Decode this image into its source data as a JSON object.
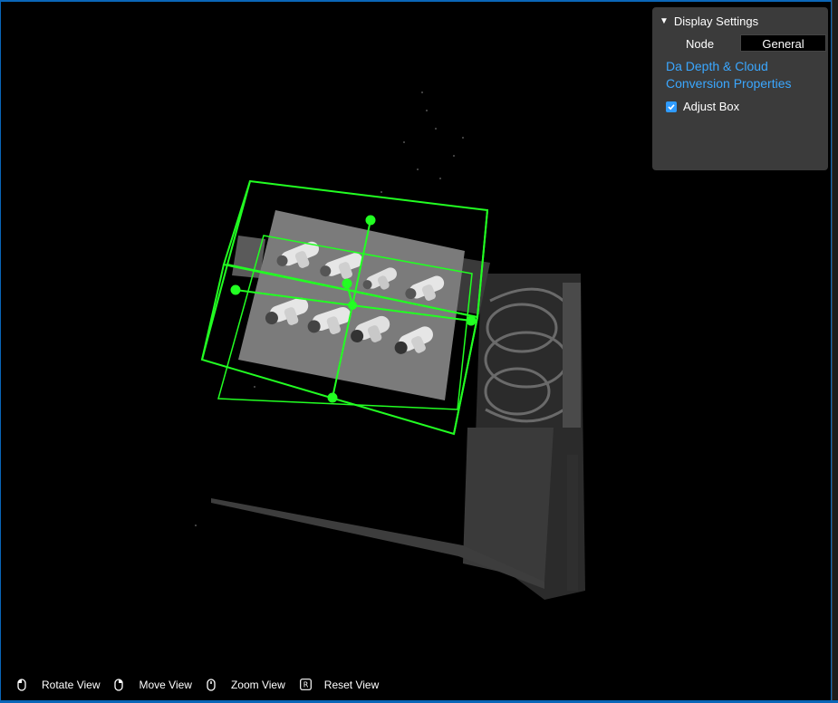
{
  "display_settings": {
    "header": "Display Settings",
    "node_label": "Node",
    "node_value": "General",
    "properties_link": "Da Depth & Cloud Conversion Properties",
    "adjust_box_label": "Adjust Box",
    "adjust_box_checked": true
  },
  "toolbar": {
    "rotate": "Rotate View",
    "move": "Move View",
    "zoom": "Zoom View",
    "reset": "Reset View",
    "reset_key": "R"
  },
  "colors": {
    "accent": "#3ba7ff",
    "bounding_box": "#22ff22",
    "frame": "#0a66b8"
  }
}
